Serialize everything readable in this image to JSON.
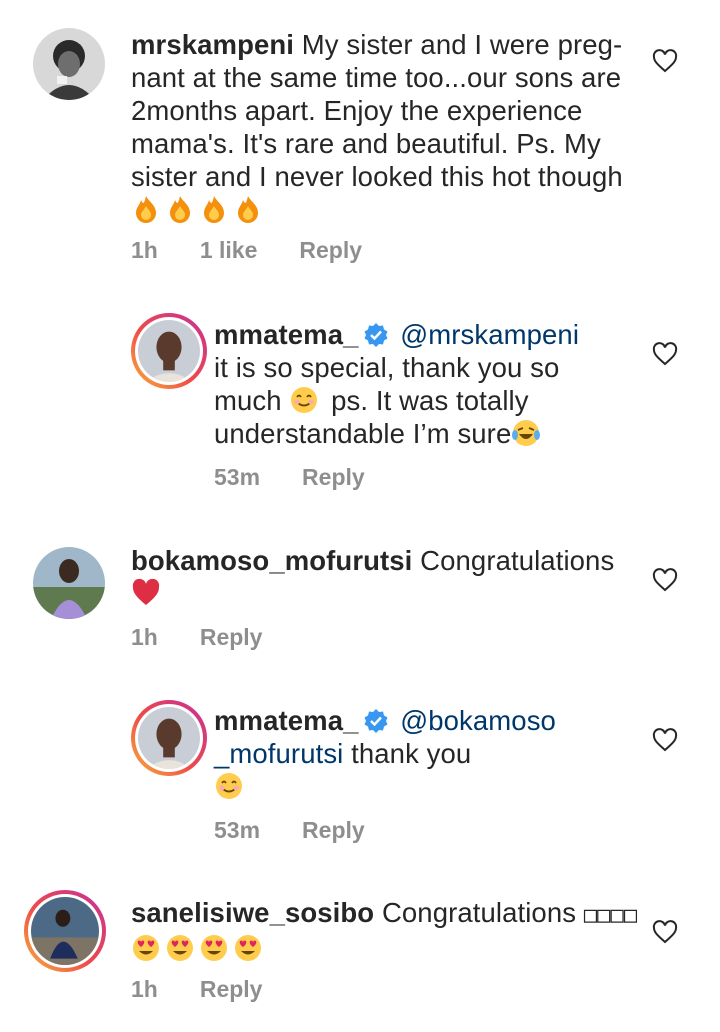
{
  "comments": [
    {
      "username": "mrskampeni",
      "lines": [
        "My sister and I were preg-",
        "nant at the same time too...our sons are",
        "2months apart. Enjoy the experience",
        "mama's. It's rare and beautiful. Ps. My",
        "sister and I never looked this hot though"
      ],
      "emoji_names": [
        "fire-emoji",
        "fire-emoji",
        "fire-emoji",
        "fire-emoji"
      ],
      "time": "1h",
      "likes": "1 like",
      "reply_label": "Reply"
    },
    {
      "username": "mmatema_",
      "mention": "@mrskampeni",
      "lines": [
        "it is so special, thank you so",
        "much",
        "ps. It was totally",
        "understandable I’m sure"
      ],
      "time": "53m",
      "reply_label": "Reply"
    },
    {
      "username": "bokamoso_mofurutsi",
      "text": "Congratulations",
      "emoji_names": [
        "red-heart-emoji"
      ],
      "time": "1h",
      "reply_label": "Reply"
    },
    {
      "username": "mmatema_",
      "mention_line1": "@bokamoso",
      "mention_line2": "_mofurutsi",
      "text": "thank you",
      "time": "53m",
      "reply_label": "Reply"
    },
    {
      "username": "sanelisiwe_sosibo",
      "text": "Congratulations",
      "missing_glyphs": "□□□□",
      "emoji_names": [
        "heart-eyes-emoji",
        "heart-eyes-emoji",
        "heart-eyes-emoji",
        "heart-eyes-emoji"
      ],
      "time": "1h",
      "reply_label": "Reply"
    }
  ],
  "colors": {
    "username": "#262626",
    "mention": "#00376b",
    "meta": "#8e8e8e",
    "verified": "#3897f0"
  }
}
